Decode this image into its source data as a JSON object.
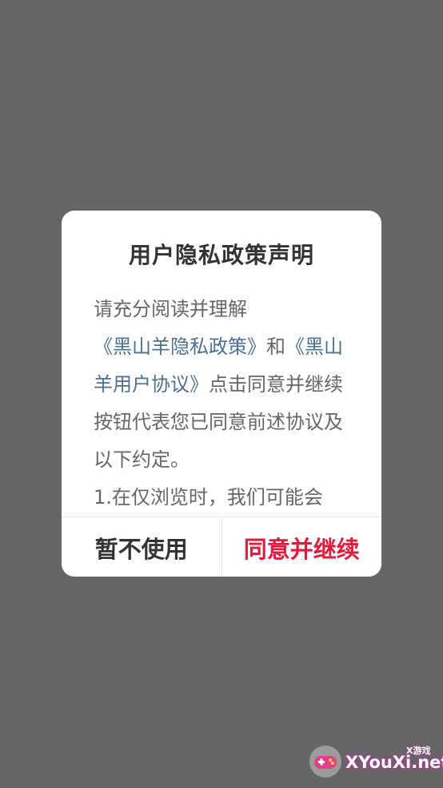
{
  "dialog": {
    "title": "用户隐私政策声明",
    "body": {
      "intro": "请充分阅读并理解",
      "privacy_link": "《黑山羊隐私政策》",
      "and": "和",
      "agreement_link": "《黑山羊用户协议》",
      "after_links": "点击同意并继续按钮代表您已同意前述协议及以下约定。",
      "item_1": "1.在仅浏览时，我们可能会"
    },
    "cancel_label": "暂不使用",
    "agree_label": "同意并继续"
  },
  "watermark": {
    "text": "XYouXi.net",
    "small_text": "X游戏"
  },
  "colors": {
    "overlay": "#666666",
    "link": "#4f6f92",
    "agree": "#e5193b"
  }
}
